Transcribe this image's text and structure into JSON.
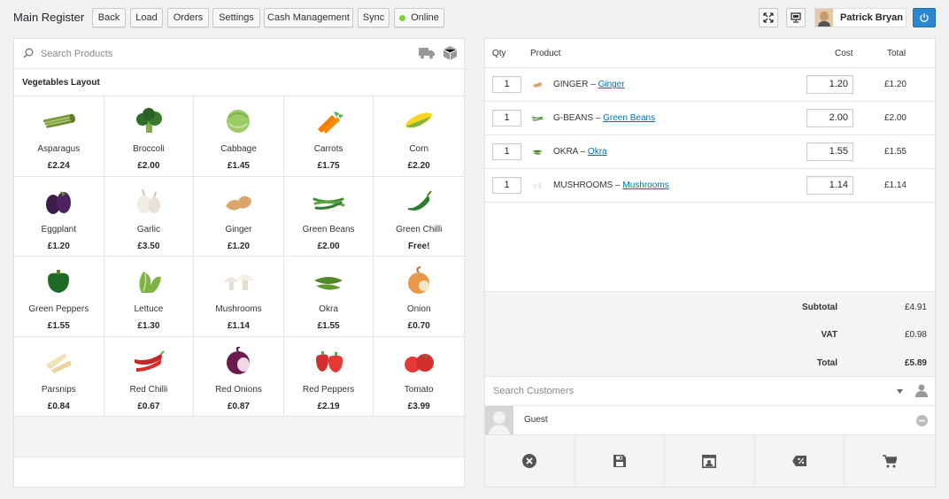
{
  "header": {
    "title": "Main Register",
    "buttons": [
      "Back",
      "Load",
      "Orders",
      "Settings",
      "Cash Management",
      "Sync",
      "Online"
    ],
    "user_name": "Patrick Bryan"
  },
  "products": {
    "search_placeholder": "Search Products",
    "layout_title": "Vegetables Layout",
    "items": [
      {
        "name": "Asparagus",
        "price": "£2.24",
        "icon": "asparagus"
      },
      {
        "name": "Broccoli",
        "price": "£2.00",
        "icon": "broccoli"
      },
      {
        "name": "Cabbage",
        "price": "£1.45",
        "icon": "cabbage"
      },
      {
        "name": "Carrots",
        "price": "£1.75",
        "icon": "carrots"
      },
      {
        "name": "Corn",
        "price": "£2.20",
        "icon": "corn"
      },
      {
        "name": "Eggplant",
        "price": "£1.20",
        "icon": "eggplant"
      },
      {
        "name": "Garlic",
        "price": "£3.50",
        "icon": "garlic"
      },
      {
        "name": "Ginger",
        "price": "£1.20",
        "icon": "ginger"
      },
      {
        "name": "Green Beans",
        "price": "£2.00",
        "icon": "green-beans"
      },
      {
        "name": "Green Chilli",
        "price": "Free!",
        "icon": "green-chilli"
      },
      {
        "name": "Green Peppers",
        "price": "£1.55",
        "icon": "green-peppers"
      },
      {
        "name": "Lettuce",
        "price": "£1.30",
        "icon": "lettuce"
      },
      {
        "name": "Mushrooms",
        "price": "£1.14",
        "icon": "mushrooms"
      },
      {
        "name": "Okra",
        "price": "£1.55",
        "icon": "okra"
      },
      {
        "name": "Onion",
        "price": "£0.70",
        "icon": "onion"
      },
      {
        "name": "Parsnips",
        "price": "£0.84",
        "icon": "parsnips"
      },
      {
        "name": "Red Chilli",
        "price": "£0.67",
        "icon": "red-chilli"
      },
      {
        "name": "Red Onions",
        "price": "£0.87",
        "icon": "red-onions"
      },
      {
        "name": "Red Peppers",
        "price": "£2.19",
        "icon": "red-peppers"
      },
      {
        "name": "Tomato",
        "price": "£3.99",
        "icon": "tomato"
      }
    ]
  },
  "cart": {
    "headers": {
      "qty": "Qty",
      "product": "Product",
      "cost": "Cost",
      "total": "Total"
    },
    "rows": [
      {
        "qty": "1",
        "sku": "GINGER",
        "link": "Ginger",
        "cost": "1.20",
        "total": "£1.20",
        "icon": "ginger"
      },
      {
        "qty": "1",
        "sku": "G-BEANS",
        "link": "Green Beans",
        "cost": "2.00",
        "total": "£2.00",
        "icon": "green-beans"
      },
      {
        "qty": "1",
        "sku": "OKRA",
        "link": "Okra",
        "cost": "1.55",
        "total": "£1.55",
        "icon": "okra"
      },
      {
        "qty": "1",
        "sku": "MUSHROOMS",
        "link": "Mushrooms",
        "cost": "1.14",
        "total": "£1.14",
        "icon": "mushrooms"
      }
    ],
    "separator": " – ",
    "totals": {
      "subtotal_label": "Subtotal",
      "subtotal": "£4.91",
      "vat_label": "VAT",
      "vat": "£0.98",
      "total_label": "Total",
      "total": "£5.89"
    }
  },
  "customer": {
    "search_placeholder": "Search Customers",
    "name": "Guest"
  },
  "colors": {
    "accent": "#2a87d0",
    "online": "#7ad03a",
    "link": "#0073aa"
  }
}
